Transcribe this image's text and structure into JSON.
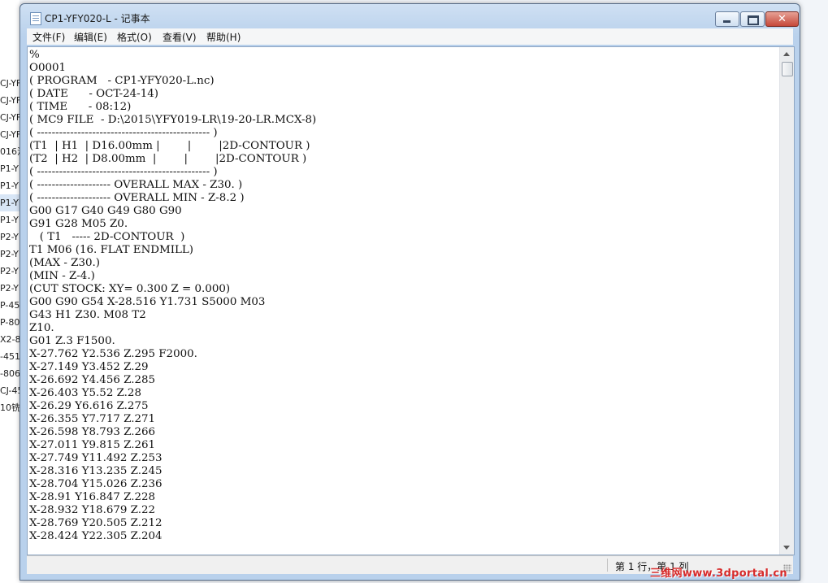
{
  "background_explorer": {
    "items": [
      "CJ-YF",
      "CJ-YF",
      "CJ-YF",
      "CJ-YF",
      "016洪",
      "P1-Y",
      "P1-Y",
      "P1-Y",
      "P1-Y",
      "P2-Y",
      "P2-Y",
      "P2-Y",
      "P2-Y",
      "P-45",
      "P-80",
      "X2-8",
      "-451",
      "-806",
      "CJ-45",
      "10铣"
    ]
  },
  "window": {
    "title": "CP1-YFY020-L - 记事本",
    "close_glyph": "✕"
  },
  "menu": {
    "file": "文件(F)",
    "edit": "编辑(E)",
    "format": "格式(O)",
    "view": "查看(V)",
    "help": "帮助(H)"
  },
  "document": {
    "lines": [
      "%",
      "O0001",
      "( PROGRAM   - CP1-YFY020-L.nc)",
      "( DATE      - OCT-24-14)",
      "( TIME      - 08:12)",
      "( MC9 FILE  - D:\\2015\\YFY019-LR\\19-20-LR.MCX-8)",
      "( ----------------------------------------------- )",
      "(T1  | H1  | D16.00mm |        |        |2D-CONTOUR )",
      "(T2  | H2  | D8.00mm  |        |        |2D-CONTOUR )",
      "( ----------------------------------------------- )",
      "( -------------------- OVERALL MAX - Z30. )",
      "( -------------------- OVERALL MIN - Z-8.2 )",
      "G00 G17 G40 G49 G80 G90",
      "G91 G28 M05 Z0.",
      "   ( T1   ----- 2D-CONTOUR  )",
      "T1 M06 (16. FLAT ENDMILL)",
      "(MAX - Z30.)",
      "(MIN - Z-4.)",
      "(CUT STOCK: XY= 0.300 Z = 0.000)",
      "G00 G90 G54 X-28.516 Y1.731 S5000 M03",
      "G43 H1 Z30. M08 T2",
      "Z10.",
      "G01 Z.3 F1500.",
      "X-27.762 Y2.536 Z.295 F2000.",
      "X-27.149 Y3.452 Z.29",
      "X-26.692 Y4.456 Z.285",
      "X-26.403 Y5.52 Z.28",
      "X-26.29 Y6.616 Z.275",
      "X-26.355 Y7.717 Z.271",
      "X-26.598 Y8.793 Z.266",
      "X-27.011 Y9.815 Z.261",
      "X-27.749 Y11.492 Z.253",
      "X-28.316 Y13.235 Z.245",
      "X-28.704 Y15.026 Z.236",
      "X-28.91 Y16.847 Z.228",
      "X-28.932 Y18.679 Z.22",
      "X-28.769 Y20.505 Z.212",
      "X-28.424 Y22.305 Z.204"
    ]
  },
  "status": {
    "position": "第 1 行，第 1 列"
  },
  "watermark": {
    "text": "三维网www.3dportal.cn"
  }
}
